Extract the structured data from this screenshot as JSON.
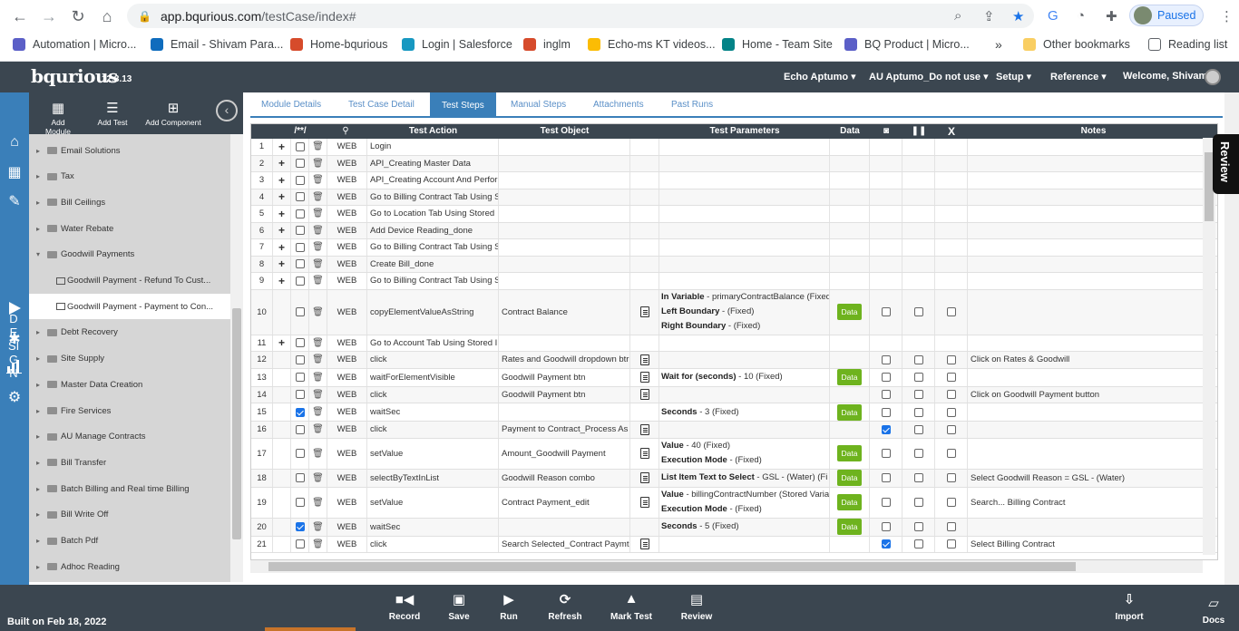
{
  "browser": {
    "url_host": "app.bqurious.com",
    "url_path": "/testCase/index#",
    "profile_label": "Paused",
    "bookmarks": [
      {
        "label": "Automation | Micro...",
        "color": "#5b5fc7"
      },
      {
        "label": "Email - Shivam Para...",
        "color": "#0f6cbd"
      },
      {
        "label": "Home-bqurious",
        "color": "#d64b2b"
      },
      {
        "label": "Login | Salesforce",
        "color": "#1798c1"
      },
      {
        "label": "inglm",
        "color": "#d64b2b"
      },
      {
        "label": "Echo-ms KT videos...",
        "color": "#fbbc04"
      },
      {
        "label": "Home - Team Site",
        "color": "#038387"
      },
      {
        "label": "BQ Product | Micro...",
        "color": "#5b5fc7"
      }
    ],
    "more": "»",
    "other_bookmarks": "Other bookmarks",
    "reading_list": "Reading list"
  },
  "app": {
    "logo": "bqurious",
    "version": "12.3.13",
    "menus": [
      "Echo Aptumo",
      "AU Aptumo_Do not use",
      "Setup",
      "Reference",
      "Welcome, Shivam"
    ]
  },
  "rail": {
    "design_label": [
      "D",
      "E",
      "SI",
      "G",
      "N"
    ]
  },
  "tools": [
    {
      "label": "Add Module",
      "icon": "grid-icon"
    },
    {
      "label": "Add Test",
      "icon": "list-icon"
    },
    {
      "label": "Add Component",
      "icon": "component-icon"
    }
  ],
  "tree": {
    "items": [
      {
        "label": "Email Solutions",
        "level": 0,
        "expanded": false
      },
      {
        "label": "Tax",
        "level": 0,
        "expanded": false
      },
      {
        "label": "Bill Ceilings",
        "level": 0,
        "expanded": false
      },
      {
        "label": "Water Rebate",
        "level": 0,
        "expanded": false
      },
      {
        "label": "Goodwill Payments",
        "level": 0,
        "expanded": true
      },
      {
        "label": "Goodwill Payment - Refund To Cust...",
        "level": 1,
        "selected": false
      },
      {
        "label": "Goodwill Payment - Payment to Con...",
        "level": 1,
        "selected": true
      },
      {
        "label": "Debt Recovery",
        "level": 0,
        "expanded": false
      },
      {
        "label": "Site Supply",
        "level": 0,
        "expanded": false
      },
      {
        "label": "Master Data Creation",
        "level": 0,
        "expanded": false
      },
      {
        "label": "Fire Services",
        "level": 0,
        "expanded": false
      },
      {
        "label": "AU Manage Contracts",
        "level": 0,
        "expanded": false
      },
      {
        "label": "Bill Transfer",
        "level": 0,
        "expanded": false
      },
      {
        "label": "Batch Billing and Real time Billing",
        "level": 0,
        "expanded": false
      },
      {
        "label": "Bill Write Off",
        "level": 0,
        "expanded": false
      },
      {
        "label": "Batch Pdf",
        "level": 0,
        "expanded": false
      },
      {
        "label": "Adhoc Reading",
        "level": 0,
        "expanded": false
      }
    ]
  },
  "tabs": [
    {
      "label": "Module Details",
      "active": false
    },
    {
      "label": "Test Case Detail",
      "active": false
    },
    {
      "label": "Test Steps",
      "active": true
    },
    {
      "label": "Manual Steps",
      "active": false
    },
    {
      "label": "Attachments",
      "active": false
    },
    {
      "label": "Past Runs",
      "active": false
    }
  ],
  "grid": {
    "headers": {
      "comment": "/**/",
      "action": "Test Action",
      "object": "Test Object",
      "params": "Test Parameters",
      "data": "Data",
      "x": "X",
      "notes": "Notes"
    },
    "rows": [
      {
        "num": "1",
        "plus": true,
        "chk": false,
        "type": "WEB",
        "action": "Login",
        "object": "",
        "doc": false,
        "params": [],
        "data": false,
        "b1": null,
        "b2": null,
        "b3": null,
        "notes": ""
      },
      {
        "num": "2",
        "plus": true,
        "chk": false,
        "type": "WEB",
        "action": "API_Creating Master Data",
        "object": "",
        "doc": false,
        "params": [],
        "data": false,
        "b1": null,
        "b2": null,
        "b3": null,
        "notes": ""
      },
      {
        "num": "3",
        "plus": true,
        "chk": false,
        "type": "WEB",
        "action": "API_Creating Account And Perfor",
        "object": "",
        "doc": false,
        "params": [],
        "data": false,
        "b1": null,
        "b2": null,
        "b3": null,
        "notes": ""
      },
      {
        "num": "4",
        "plus": true,
        "chk": false,
        "type": "WEB",
        "action": "Go to Billing Contract Tab Using S",
        "object": "",
        "doc": false,
        "params": [],
        "data": false,
        "b1": null,
        "b2": null,
        "b3": null,
        "notes": ""
      },
      {
        "num": "5",
        "plus": true,
        "chk": false,
        "type": "WEB",
        "action": "Go to Location Tab Using Stored",
        "object": "",
        "doc": false,
        "params": [],
        "data": false,
        "b1": null,
        "b2": null,
        "b3": null,
        "notes": ""
      },
      {
        "num": "6",
        "plus": true,
        "chk": false,
        "type": "WEB",
        "action": "Add Device Reading_done",
        "object": "",
        "doc": false,
        "params": [],
        "data": false,
        "b1": null,
        "b2": null,
        "b3": null,
        "notes": ""
      },
      {
        "num": "7",
        "plus": true,
        "chk": false,
        "type": "WEB",
        "action": "Go to Billing Contract Tab Using S",
        "object": "",
        "doc": false,
        "params": [],
        "data": false,
        "b1": null,
        "b2": null,
        "b3": null,
        "notes": ""
      },
      {
        "num": "8",
        "plus": true,
        "chk": false,
        "type": "WEB",
        "action": "Create Bill_done",
        "object": "",
        "doc": false,
        "params": [],
        "data": false,
        "b1": null,
        "b2": null,
        "b3": null,
        "notes": ""
      },
      {
        "num": "9",
        "plus": true,
        "chk": false,
        "type": "WEB",
        "action": "Go to Billing Contract Tab Using S",
        "object": "",
        "doc": false,
        "params": [],
        "data": false,
        "b1": null,
        "b2": null,
        "b3": null,
        "notes": ""
      },
      {
        "num": "10",
        "plus": false,
        "chk": false,
        "type": "WEB",
        "action": "copyElementValueAsString",
        "object": "Contract Balance",
        "doc": true,
        "params": [
          {
            "k": "In Variable",
            "v": " - primaryContractBalance (Fixed"
          },
          {
            "k": "Left Boundary",
            "v": " -  (Fixed)"
          },
          {
            "k": "Right Boundary",
            "v": " -  (Fixed)"
          }
        ],
        "data": true,
        "b1": false,
        "b2": false,
        "b3": false,
        "notes": ""
      },
      {
        "num": "11",
        "plus": true,
        "chk": false,
        "type": "WEB",
        "action": "Go to Account Tab Using Stored I",
        "object": "",
        "doc": false,
        "params": [],
        "data": false,
        "b1": null,
        "b2": null,
        "b3": null,
        "notes": ""
      },
      {
        "num": "12",
        "plus": false,
        "chk": false,
        "type": "WEB",
        "action": "click",
        "object": "Rates and Goodwill dropdown btr",
        "doc": true,
        "params": [],
        "data": false,
        "b1": false,
        "b2": false,
        "b3": false,
        "notes": "Click on Rates & Goodwill"
      },
      {
        "num": "13",
        "plus": false,
        "chk": false,
        "type": "WEB",
        "action": "waitForElementVisible",
        "object": "Goodwill Payment btn",
        "doc": true,
        "params": [
          {
            "k": "Wait for (seconds)",
            "v": " - 10 (Fixed)"
          }
        ],
        "data": true,
        "b1": false,
        "b2": false,
        "b3": false,
        "notes": ""
      },
      {
        "num": "14",
        "plus": false,
        "chk": false,
        "type": "WEB",
        "action": "click",
        "object": "Goodwill Payment btn",
        "doc": true,
        "params": [],
        "data": false,
        "b1": false,
        "b2": false,
        "b3": false,
        "notes": "Click on Goodwill Payment button"
      },
      {
        "num": "15",
        "plus": false,
        "chk": true,
        "type": "WEB",
        "action": "waitSec",
        "object": "",
        "doc": false,
        "params": [
          {
            "k": "Seconds",
            "v": " - 3 (Fixed)"
          }
        ],
        "data": true,
        "b1": false,
        "b2": false,
        "b3": false,
        "notes": ""
      },
      {
        "num": "16",
        "plus": false,
        "chk": false,
        "type": "WEB",
        "action": "click",
        "object": "Payment to Contract_Process As",
        "doc": true,
        "params": [],
        "data": false,
        "b1": true,
        "b2": false,
        "b3": false,
        "notes": ""
      },
      {
        "num": "17",
        "plus": false,
        "chk": false,
        "type": "WEB",
        "action": "setValue",
        "object": "Amount_Goodwill Payment",
        "doc": true,
        "params": [
          {
            "k": "Value",
            "v": " - 40 (Fixed)"
          },
          {
            "k": "Execution Mode",
            "v": " -  (Fixed)"
          }
        ],
        "data": true,
        "b1": false,
        "b2": false,
        "b3": false,
        "notes": ""
      },
      {
        "num": "18",
        "plus": false,
        "chk": false,
        "type": "WEB",
        "action": "selectByTextInList",
        "object": "Goodwill Reason combo",
        "doc": true,
        "params": [
          {
            "k": "List Item Text to Select",
            "v": " - GSL - (Water) (Fi"
          }
        ],
        "data": true,
        "b1": false,
        "b2": false,
        "b3": false,
        "notes": "Select Goodwill Reason = GSL - (Water)"
      },
      {
        "num": "19",
        "plus": false,
        "chk": false,
        "type": "WEB",
        "action": "setValue",
        "object": "Contract Payment_edit",
        "doc": true,
        "params": [
          {
            "k": "Value",
            "v": " - billingContractNumber (Stored Varia"
          },
          {
            "k": "Execution Mode",
            "v": " -  (Fixed)"
          }
        ],
        "data": true,
        "b1": false,
        "b2": false,
        "b3": false,
        "notes": "Search... Billing Contract"
      },
      {
        "num": "20",
        "plus": false,
        "chk": true,
        "type": "WEB",
        "action": "waitSec",
        "object": "",
        "doc": false,
        "params": [
          {
            "k": "Seconds",
            "v": " - 5 (Fixed)"
          }
        ],
        "data": true,
        "b1": false,
        "b2": false,
        "b3": false,
        "notes": ""
      },
      {
        "num": "21",
        "plus": false,
        "chk": false,
        "type": "WEB",
        "action": "click",
        "object": "Search Selected_Contract Paymt",
        "doc": true,
        "params": [],
        "data": false,
        "b1": true,
        "b2": false,
        "b3": false,
        "notes": "Select Billing Contract"
      }
    ],
    "data_label": "Data"
  },
  "review_label": "Review",
  "footer": {
    "built": "Built on Feb 18, 2022",
    "buttons": [
      {
        "label": "Record",
        "icon": "camera-icon"
      },
      {
        "label": "Save",
        "icon": "save-icon"
      },
      {
        "label": "Run",
        "icon": "play-icon"
      },
      {
        "label": "Refresh",
        "icon": "refresh-icon"
      },
      {
        "label": "Mark Test",
        "icon": "warning-icon"
      },
      {
        "label": "Review",
        "icon": "review-icon"
      }
    ],
    "import": "Import",
    "docs": "Docs"
  }
}
